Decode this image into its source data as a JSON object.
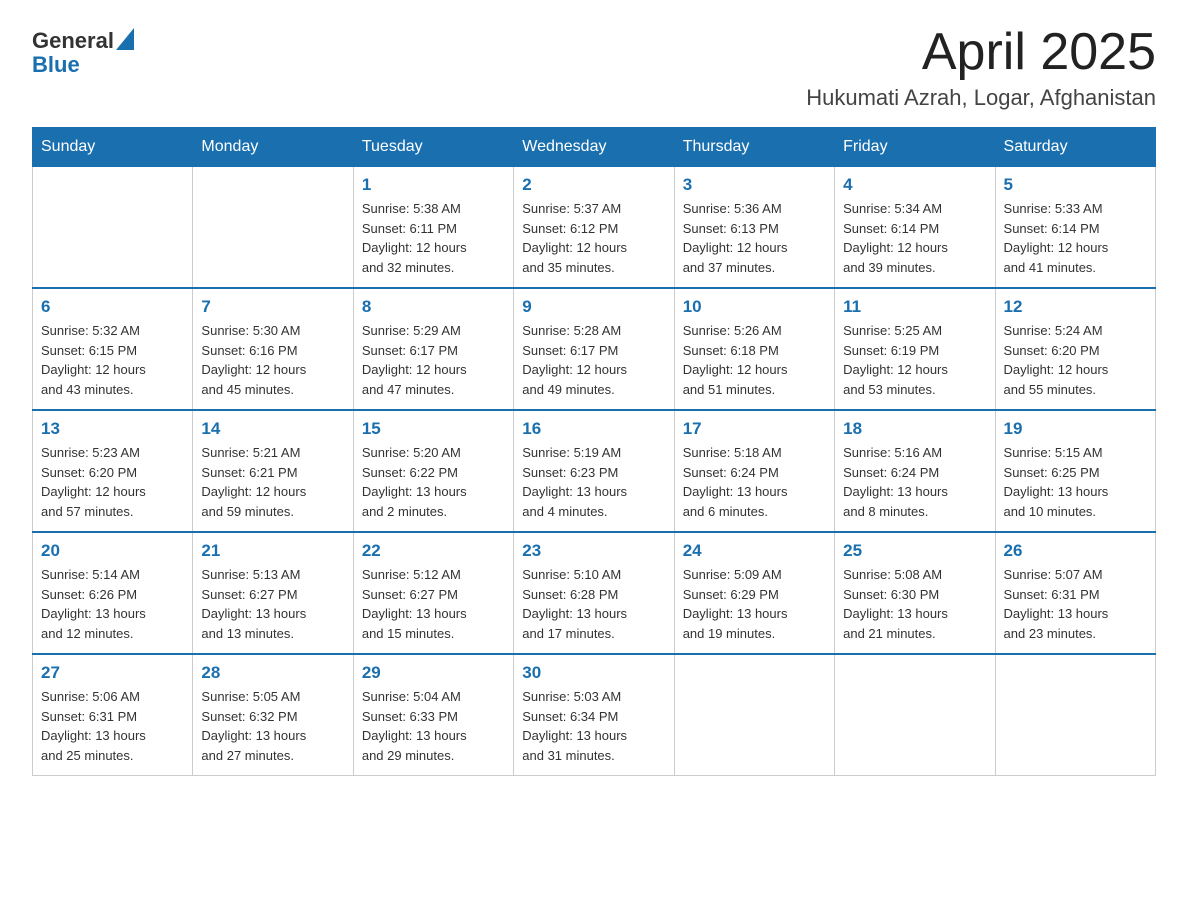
{
  "header": {
    "logo_general": "General",
    "logo_blue": "Blue",
    "title": "April 2025",
    "subtitle": "Hukumati Azrah, Logar, Afghanistan"
  },
  "weekdays": [
    "Sunday",
    "Monday",
    "Tuesday",
    "Wednesday",
    "Thursday",
    "Friday",
    "Saturday"
  ],
  "weeks": [
    [
      {
        "day": "",
        "info": ""
      },
      {
        "day": "",
        "info": ""
      },
      {
        "day": "1",
        "info": "Sunrise: 5:38 AM\nSunset: 6:11 PM\nDaylight: 12 hours\nand 32 minutes."
      },
      {
        "day": "2",
        "info": "Sunrise: 5:37 AM\nSunset: 6:12 PM\nDaylight: 12 hours\nand 35 minutes."
      },
      {
        "day": "3",
        "info": "Sunrise: 5:36 AM\nSunset: 6:13 PM\nDaylight: 12 hours\nand 37 minutes."
      },
      {
        "day": "4",
        "info": "Sunrise: 5:34 AM\nSunset: 6:14 PM\nDaylight: 12 hours\nand 39 minutes."
      },
      {
        "day": "5",
        "info": "Sunrise: 5:33 AM\nSunset: 6:14 PM\nDaylight: 12 hours\nand 41 minutes."
      }
    ],
    [
      {
        "day": "6",
        "info": "Sunrise: 5:32 AM\nSunset: 6:15 PM\nDaylight: 12 hours\nand 43 minutes."
      },
      {
        "day": "7",
        "info": "Sunrise: 5:30 AM\nSunset: 6:16 PM\nDaylight: 12 hours\nand 45 minutes."
      },
      {
        "day": "8",
        "info": "Sunrise: 5:29 AM\nSunset: 6:17 PM\nDaylight: 12 hours\nand 47 minutes."
      },
      {
        "day": "9",
        "info": "Sunrise: 5:28 AM\nSunset: 6:17 PM\nDaylight: 12 hours\nand 49 minutes."
      },
      {
        "day": "10",
        "info": "Sunrise: 5:26 AM\nSunset: 6:18 PM\nDaylight: 12 hours\nand 51 minutes."
      },
      {
        "day": "11",
        "info": "Sunrise: 5:25 AM\nSunset: 6:19 PM\nDaylight: 12 hours\nand 53 minutes."
      },
      {
        "day": "12",
        "info": "Sunrise: 5:24 AM\nSunset: 6:20 PM\nDaylight: 12 hours\nand 55 minutes."
      }
    ],
    [
      {
        "day": "13",
        "info": "Sunrise: 5:23 AM\nSunset: 6:20 PM\nDaylight: 12 hours\nand 57 minutes."
      },
      {
        "day": "14",
        "info": "Sunrise: 5:21 AM\nSunset: 6:21 PM\nDaylight: 12 hours\nand 59 minutes."
      },
      {
        "day": "15",
        "info": "Sunrise: 5:20 AM\nSunset: 6:22 PM\nDaylight: 13 hours\nand 2 minutes."
      },
      {
        "day": "16",
        "info": "Sunrise: 5:19 AM\nSunset: 6:23 PM\nDaylight: 13 hours\nand 4 minutes."
      },
      {
        "day": "17",
        "info": "Sunrise: 5:18 AM\nSunset: 6:24 PM\nDaylight: 13 hours\nand 6 minutes."
      },
      {
        "day": "18",
        "info": "Sunrise: 5:16 AM\nSunset: 6:24 PM\nDaylight: 13 hours\nand 8 minutes."
      },
      {
        "day": "19",
        "info": "Sunrise: 5:15 AM\nSunset: 6:25 PM\nDaylight: 13 hours\nand 10 minutes."
      }
    ],
    [
      {
        "day": "20",
        "info": "Sunrise: 5:14 AM\nSunset: 6:26 PM\nDaylight: 13 hours\nand 12 minutes."
      },
      {
        "day": "21",
        "info": "Sunrise: 5:13 AM\nSunset: 6:27 PM\nDaylight: 13 hours\nand 13 minutes."
      },
      {
        "day": "22",
        "info": "Sunrise: 5:12 AM\nSunset: 6:27 PM\nDaylight: 13 hours\nand 15 minutes."
      },
      {
        "day": "23",
        "info": "Sunrise: 5:10 AM\nSunset: 6:28 PM\nDaylight: 13 hours\nand 17 minutes."
      },
      {
        "day": "24",
        "info": "Sunrise: 5:09 AM\nSunset: 6:29 PM\nDaylight: 13 hours\nand 19 minutes."
      },
      {
        "day": "25",
        "info": "Sunrise: 5:08 AM\nSunset: 6:30 PM\nDaylight: 13 hours\nand 21 minutes."
      },
      {
        "day": "26",
        "info": "Sunrise: 5:07 AM\nSunset: 6:31 PM\nDaylight: 13 hours\nand 23 minutes."
      }
    ],
    [
      {
        "day": "27",
        "info": "Sunrise: 5:06 AM\nSunset: 6:31 PM\nDaylight: 13 hours\nand 25 minutes."
      },
      {
        "day": "28",
        "info": "Sunrise: 5:05 AM\nSunset: 6:32 PM\nDaylight: 13 hours\nand 27 minutes."
      },
      {
        "day": "29",
        "info": "Sunrise: 5:04 AM\nSunset: 6:33 PM\nDaylight: 13 hours\nand 29 minutes."
      },
      {
        "day": "30",
        "info": "Sunrise: 5:03 AM\nSunset: 6:34 PM\nDaylight: 13 hours\nand 31 minutes."
      },
      {
        "day": "",
        "info": ""
      },
      {
        "day": "",
        "info": ""
      },
      {
        "day": "",
        "info": ""
      }
    ]
  ]
}
